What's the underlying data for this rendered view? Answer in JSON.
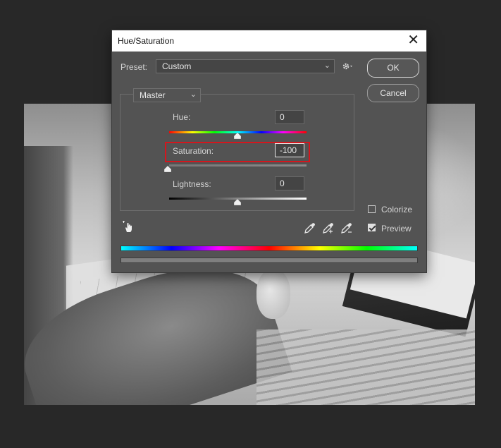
{
  "dialog": {
    "title": "Hue/Saturation",
    "close_glyph": "✕",
    "preset_label": "Preset:",
    "preset_value": "Custom",
    "ok_label": "OK",
    "cancel_label": "Cancel",
    "channel_value": "Master",
    "hue": {
      "label": "Hue:",
      "value": "0",
      "position": 0.5
    },
    "saturation": {
      "label": "Saturation:",
      "value": "-100",
      "position": 0.0
    },
    "lightness": {
      "label": "Lightness:",
      "value": "0",
      "position": 0.5
    },
    "colorize": {
      "label": "Colorize",
      "checked": false
    },
    "preview": {
      "label": "Preview",
      "checked": true
    },
    "icons": [
      "settings-gear-icon",
      "targeted-adjustment-hand-icon",
      "eyedropper-icon",
      "eyedropper-plus-icon",
      "eyedropper-minus-icon"
    ],
    "highlight_color": "#d4161d"
  }
}
